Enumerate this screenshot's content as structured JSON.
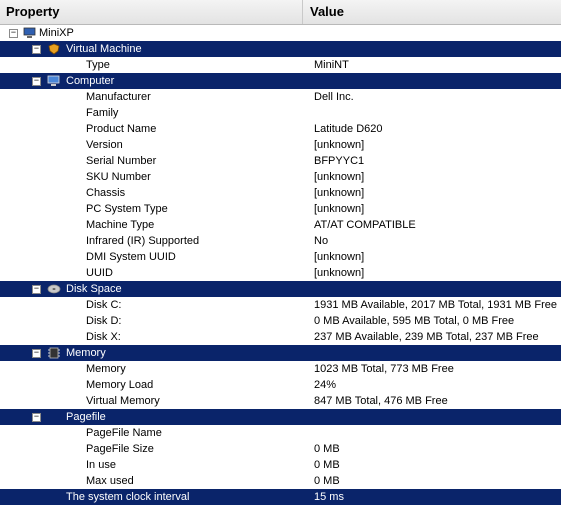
{
  "header": {
    "property": "Property",
    "value": "Value"
  },
  "root": {
    "label": "MiniXP",
    "icon": "computer-icon"
  },
  "sections": [
    {
      "key": "vm",
      "label": "Virtual Machine",
      "icon": "shield-icon",
      "rows": [
        {
          "prop": "Type",
          "val": "MiniNT"
        }
      ]
    },
    {
      "key": "computer",
      "label": "Computer",
      "icon": "computer-icon",
      "rows": [
        {
          "prop": "Manufacturer",
          "val": "Dell Inc."
        },
        {
          "prop": "Family",
          "val": ""
        },
        {
          "prop": "Product Name",
          "val": "Latitude D620"
        },
        {
          "prop": "Version",
          "val": "[unknown]"
        },
        {
          "prop": "Serial Number",
          "val": "BFPYYC1"
        },
        {
          "prop": "SKU Number",
          "val": "[unknown]"
        },
        {
          "prop": "Chassis",
          "val": "[unknown]"
        },
        {
          "prop": "PC System Type",
          "val": "[unknown]"
        },
        {
          "prop": "Machine Type",
          "val": "AT/AT COMPATIBLE"
        },
        {
          "prop": "Infrared (IR) Supported",
          "val": "No"
        },
        {
          "prop": "DMI System UUID",
          "val": "[unknown]"
        },
        {
          "prop": "UUID",
          "val": "[unknown]"
        }
      ]
    },
    {
      "key": "disk",
      "label": "Disk Space",
      "icon": "disk-icon",
      "rows": [
        {
          "prop": "Disk C:",
          "val": "1931 MB Available, 2017 MB Total, 1931 MB Free"
        },
        {
          "prop": "Disk D:",
          "val": "0 MB Available, 595 MB Total, 0 MB Free"
        },
        {
          "prop": "Disk X:",
          "val": "237 MB Available, 239 MB Total, 237 MB Free"
        }
      ]
    },
    {
      "key": "memory",
      "label": "Memory",
      "icon": "memory-chip-icon",
      "rows": [
        {
          "prop": "Memory",
          "val": "1023 MB Total, 773 MB Free"
        },
        {
          "prop": "Memory Load",
          "val": "24%"
        },
        {
          "prop": "Virtual Memory",
          "val": "847 MB Total, 476 MB Free"
        }
      ]
    },
    {
      "key": "pagefile",
      "label": "Pagefile",
      "icon": "",
      "rows": [
        {
          "prop": "PageFile Name",
          "val": ""
        },
        {
          "prop": "PageFile Size",
          "val": "0 MB"
        },
        {
          "prop": "In use",
          "val": "0 MB"
        },
        {
          "prop": "Max used",
          "val": "0 MB"
        }
      ]
    }
  ],
  "clock": {
    "label": "The system clock interval",
    "val": "15 ms"
  },
  "colors": {
    "selected_bg": "#0a246a",
    "header_bg": "#ebebeb"
  }
}
